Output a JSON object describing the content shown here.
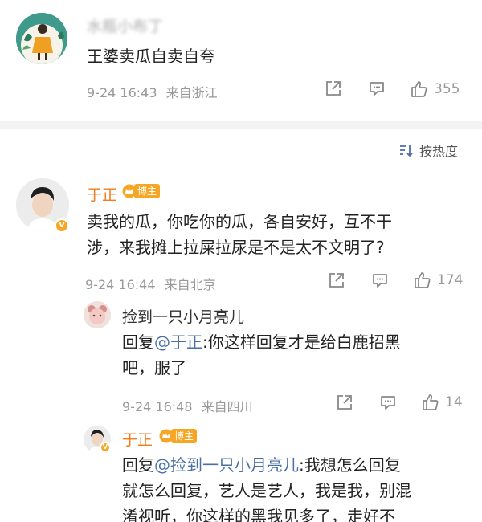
{
  "comment1": {
    "username": "水瓶小布丁",
    "text": "王婆卖瓜自卖自夸",
    "time": "9-24 16:43",
    "location": "来自浙江",
    "likes": "355",
    "share_icon": "share-icon",
    "comment_icon": "comment-icon",
    "like_icon": "thumbs-up-icon"
  },
  "sort": {
    "label": "按热度",
    "icon": "sort-icon"
  },
  "comment2": {
    "username": "于正",
    "badge": "博主",
    "text_line1": "卖我的瓜，你吃你的瓜，各自安好，互不干",
    "text_line2": "涉，来我摊上拉屎拉尿是不是太不文明了?",
    "time": "9-24 16:44",
    "location": "来自北京",
    "likes": "174"
  },
  "reply1": {
    "username": "捡到一只小月亮儿",
    "prefix": "回复",
    "mention": "@于正",
    "text_line1": ":你这样回复才是给白鹿招黑",
    "text_line2": "吧，服了",
    "time": "9-24 16:48",
    "location": "来自四川",
    "likes": "14"
  },
  "reply2": {
    "username": "于正",
    "badge": "博主",
    "prefix": "回复",
    "mention": "@捡到一只小月亮儿",
    "text_line1": ":我想怎么回复",
    "text_line2": "就怎么回复，艺人是艺人，我是我，别混",
    "text_line3": "淆视听，你这样的黑我见多了，走好不"
  },
  "colors": {
    "orange": "#f07c1e",
    "badge": "#f5a623",
    "link": "#4a6fa5",
    "meta": "#999999"
  }
}
